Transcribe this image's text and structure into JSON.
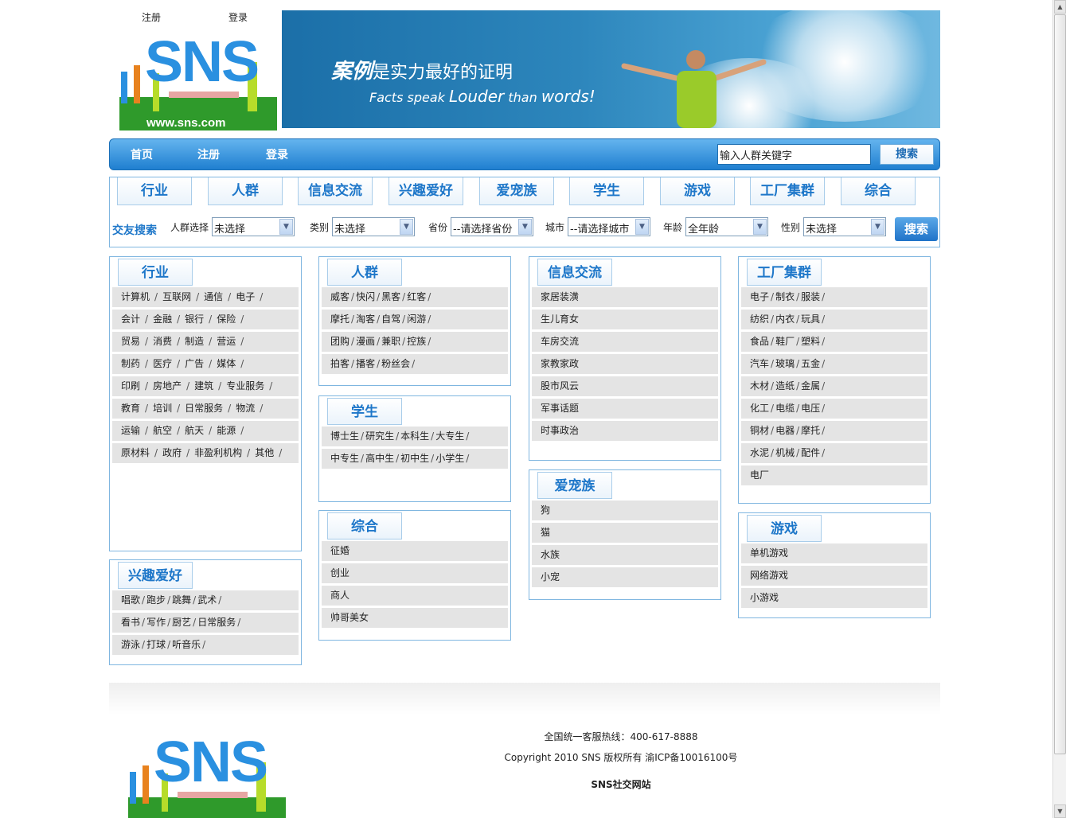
{
  "header": {
    "register": "注册",
    "login": "登录"
  },
  "banner": {
    "slogan_cn_emph": "案例",
    "slogan_cn_rest": "是实力最好的证明",
    "slogan_en_1": "Facts speak ",
    "slogan_en_2": "Louder",
    "slogan_en_3": " than ",
    "slogan_en_4": "words!"
  },
  "logo": {
    "text": "SNS",
    "url_text": "www.sns.com"
  },
  "nav": {
    "items": [
      "首页",
      "注册",
      "登录"
    ],
    "search_value": "输入人群关键字",
    "search_button": "搜索"
  },
  "categories": [
    "行业",
    "人群",
    "信息交流",
    "兴趣爱好",
    "爱宠族",
    "学生",
    "游戏",
    "工厂集群",
    "综合"
  ],
  "filter": {
    "title": "交友搜索",
    "fields": [
      {
        "label": "人群选择",
        "value": "未选择"
      },
      {
        "label": "类别",
        "value": "未选择"
      },
      {
        "label": "省份",
        "value": "--请选择省份"
      },
      {
        "label": "城市",
        "value": "--请选择城市"
      },
      {
        "label": "年龄",
        "value": "全年龄"
      },
      {
        "label": "性别",
        "value": "未选择"
      }
    ],
    "button": "搜索"
  },
  "sections": {
    "hangye": {
      "title": "行业",
      "rows": [
        [
          "计算机",
          "互联网",
          "通信",
          "电子"
        ],
        [
          "会计",
          "金融",
          "银行",
          "保险"
        ],
        [
          "贸易",
          "消费",
          "制造",
          "营运"
        ],
        [
          "制药",
          "医疗",
          "广告",
          "媒体"
        ],
        [
          "印刷",
          "房地产",
          "建筑",
          "专业服务"
        ],
        [
          "教育",
          "培训",
          "日常服务",
          "物流"
        ],
        [
          "运输",
          "航空",
          "航天",
          "能源"
        ],
        [
          "原材料",
          "政府",
          "非盈利机构",
          "其他"
        ]
      ]
    },
    "xingqu": {
      "title": "兴趣爱好",
      "rows": [
        [
          "唱歌",
          "跑步",
          "跳舞",
          "武术"
        ],
        [
          "看书",
          "写作",
          "厨艺",
          "日常服务"
        ],
        [
          "游泳",
          "打球",
          "听音乐"
        ]
      ]
    },
    "renqun": {
      "title": "人群",
      "rows": [
        [
          "威客",
          "快闪",
          "黑客",
          "红客"
        ],
        [
          "摩托",
          "淘客",
          "自驾",
          "闲游"
        ],
        [
          "团购",
          "漫画",
          "兼职",
          "控族"
        ],
        [
          "拍客",
          "播客",
          "粉丝会"
        ]
      ]
    },
    "xuesheng": {
      "title": "学生",
      "rows": [
        [
          "博士生",
          "研究生",
          "本科生",
          "大专生"
        ],
        [
          "中专生",
          "高中生",
          "初中生",
          "小学生"
        ]
      ]
    },
    "zonghe": {
      "title": "综合",
      "rows": [
        [
          "征婚"
        ],
        [
          "创业"
        ],
        [
          "商人"
        ],
        [
          "帅哥美女"
        ]
      ]
    },
    "xinxi": {
      "title": "信息交流",
      "rows": [
        [
          "家居装潢"
        ],
        [
          "生儿育女"
        ],
        [
          "车房交流"
        ],
        [
          "家教家政"
        ],
        [
          "股市风云"
        ],
        [
          "军事话题"
        ],
        [
          "时事政治"
        ]
      ]
    },
    "aichong": {
      "title": "爱宠族",
      "rows": [
        [
          "狗"
        ],
        [
          "猫"
        ],
        [
          "水族"
        ],
        [
          "小宠"
        ]
      ]
    },
    "gongchang": {
      "title": "工厂集群",
      "rows": [
        [
          "电子",
          "制衣",
          "服装"
        ],
        [
          "纺织",
          "内衣",
          "玩具"
        ],
        [
          "食品",
          "鞋厂",
          "塑料"
        ],
        [
          "汽车",
          "玻璃",
          "五金"
        ],
        [
          "木材",
          "造纸",
          "金属"
        ],
        [
          "化工",
          "电缆",
          "电压"
        ],
        [
          "铜材",
          "电器",
          "摩托"
        ],
        [
          "水泥",
          "机械",
          "配件"
        ],
        [
          "电厂"
        ]
      ]
    },
    "youxi": {
      "title": "游戏",
      "rows": [
        [
          "单机游戏"
        ],
        [
          "网络游戏"
        ],
        [
          "小游戏"
        ]
      ]
    }
  },
  "footer": {
    "hotline": "全国统一客服热线：400-617-8888",
    "copyright": "Copyright 2010 SNS 版权所有 渝ICP备10016100号",
    "site": "SNS社交网站"
  }
}
